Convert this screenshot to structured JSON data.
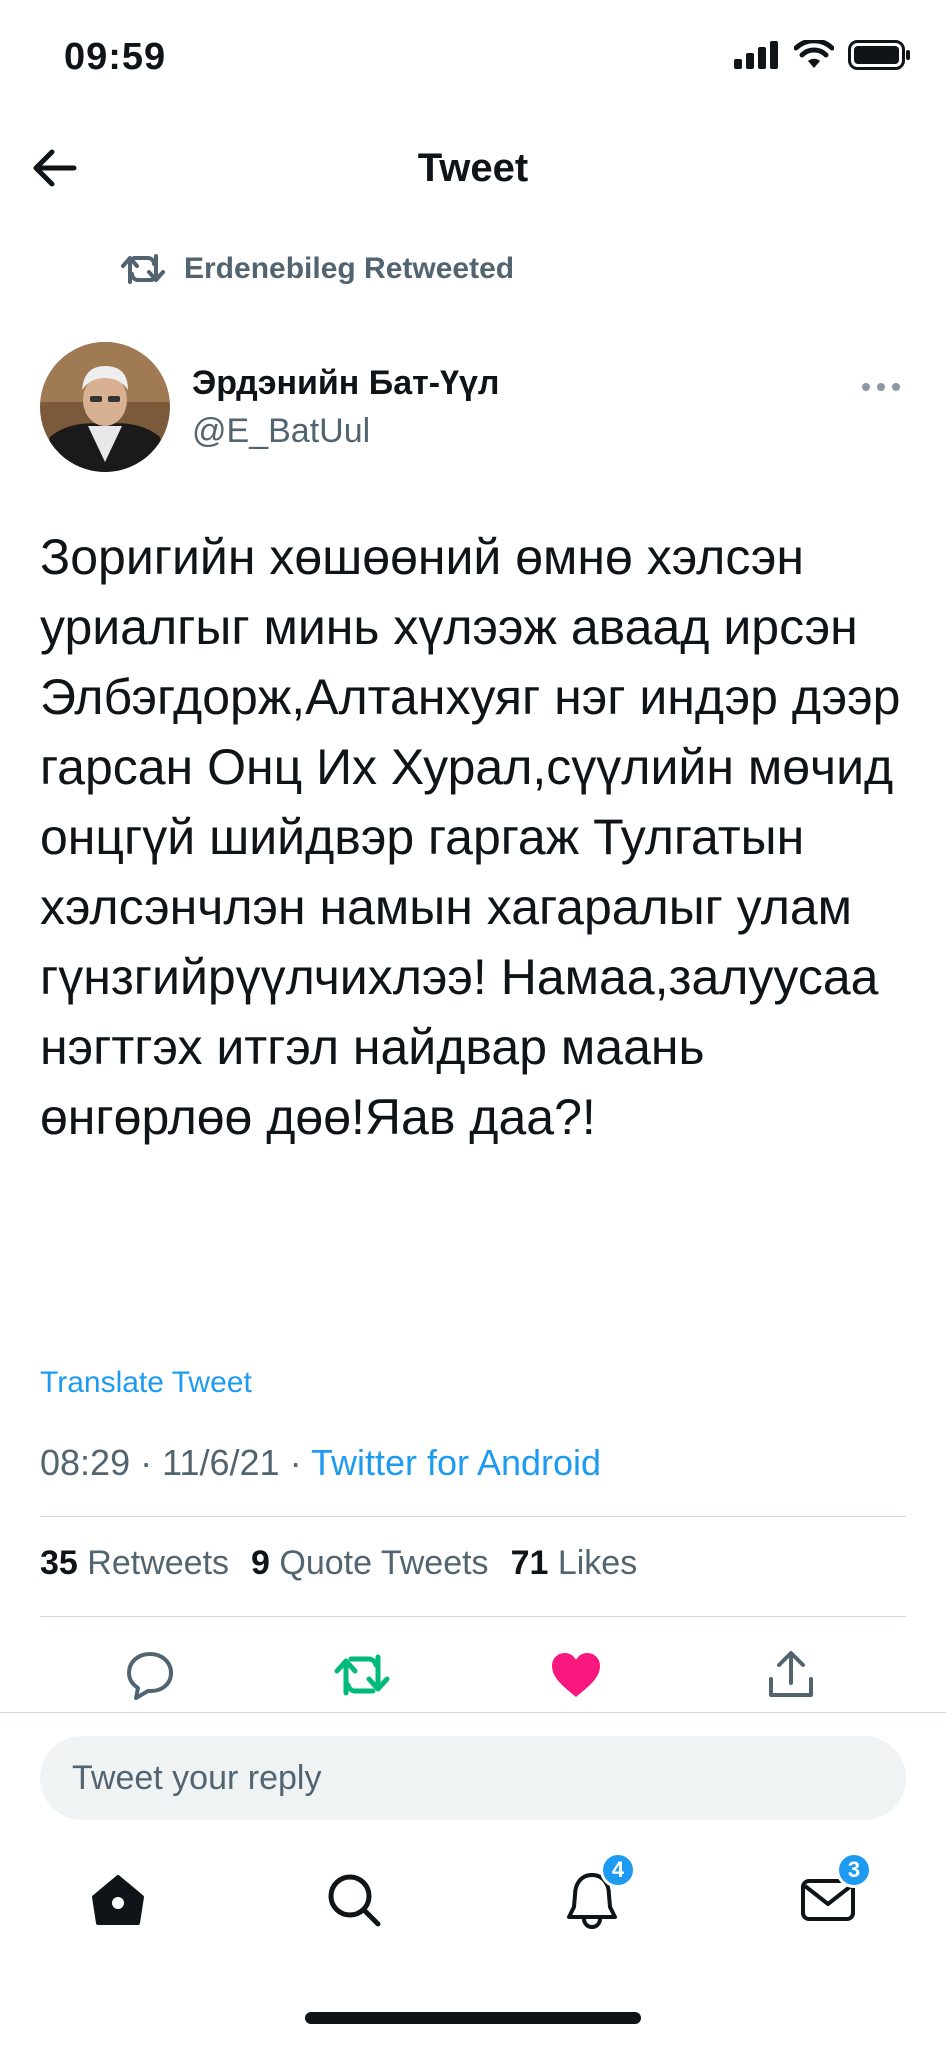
{
  "status_bar": {
    "time": "09:59"
  },
  "header": {
    "title": "Tweet"
  },
  "retweet_banner": {
    "text": "Erdenebileg Retweeted"
  },
  "author": {
    "name": "Эрдэнийн Бат-Үүл",
    "handle": "@E_BatUul"
  },
  "tweet": {
    "text": "Зоригийн хөшөөний өмнө хэлсэн уриалгыг минь хүлээж аваад ирсэн Элбэгдорж,Алтанхуяг нэг индэр дээр гарсан Онц Их Хурал,сүүлийн мөчид онцгүй шийдвэр гаргаж Тулгатын хэлсэнчлэн намын хагаралыг улам гүнзгийрүүлчихлээ! Намаа,залуусаа нэгтгэх итгэл найдвар маань өнгөрлөө дөө!Яав даа?!",
    "translate_label": "Translate Tweet",
    "time": "08:29",
    "separator": "·",
    "date": "11/6/21",
    "client": "Twitter for Android"
  },
  "stats": {
    "retweets_count": "35",
    "retweets_label": "Retweets",
    "quotes_count": "9",
    "quotes_label": "Quote Tweets",
    "likes_count": "71",
    "likes_label": "Likes"
  },
  "reply": {
    "placeholder": "Tweet your reply"
  },
  "tabbar": {
    "notifications_badge": "4",
    "messages_badge": "3"
  },
  "colors": {
    "accent": "#1d9bf0",
    "retweet_green": "#00ba7c",
    "like_pink": "#f91880"
  }
}
